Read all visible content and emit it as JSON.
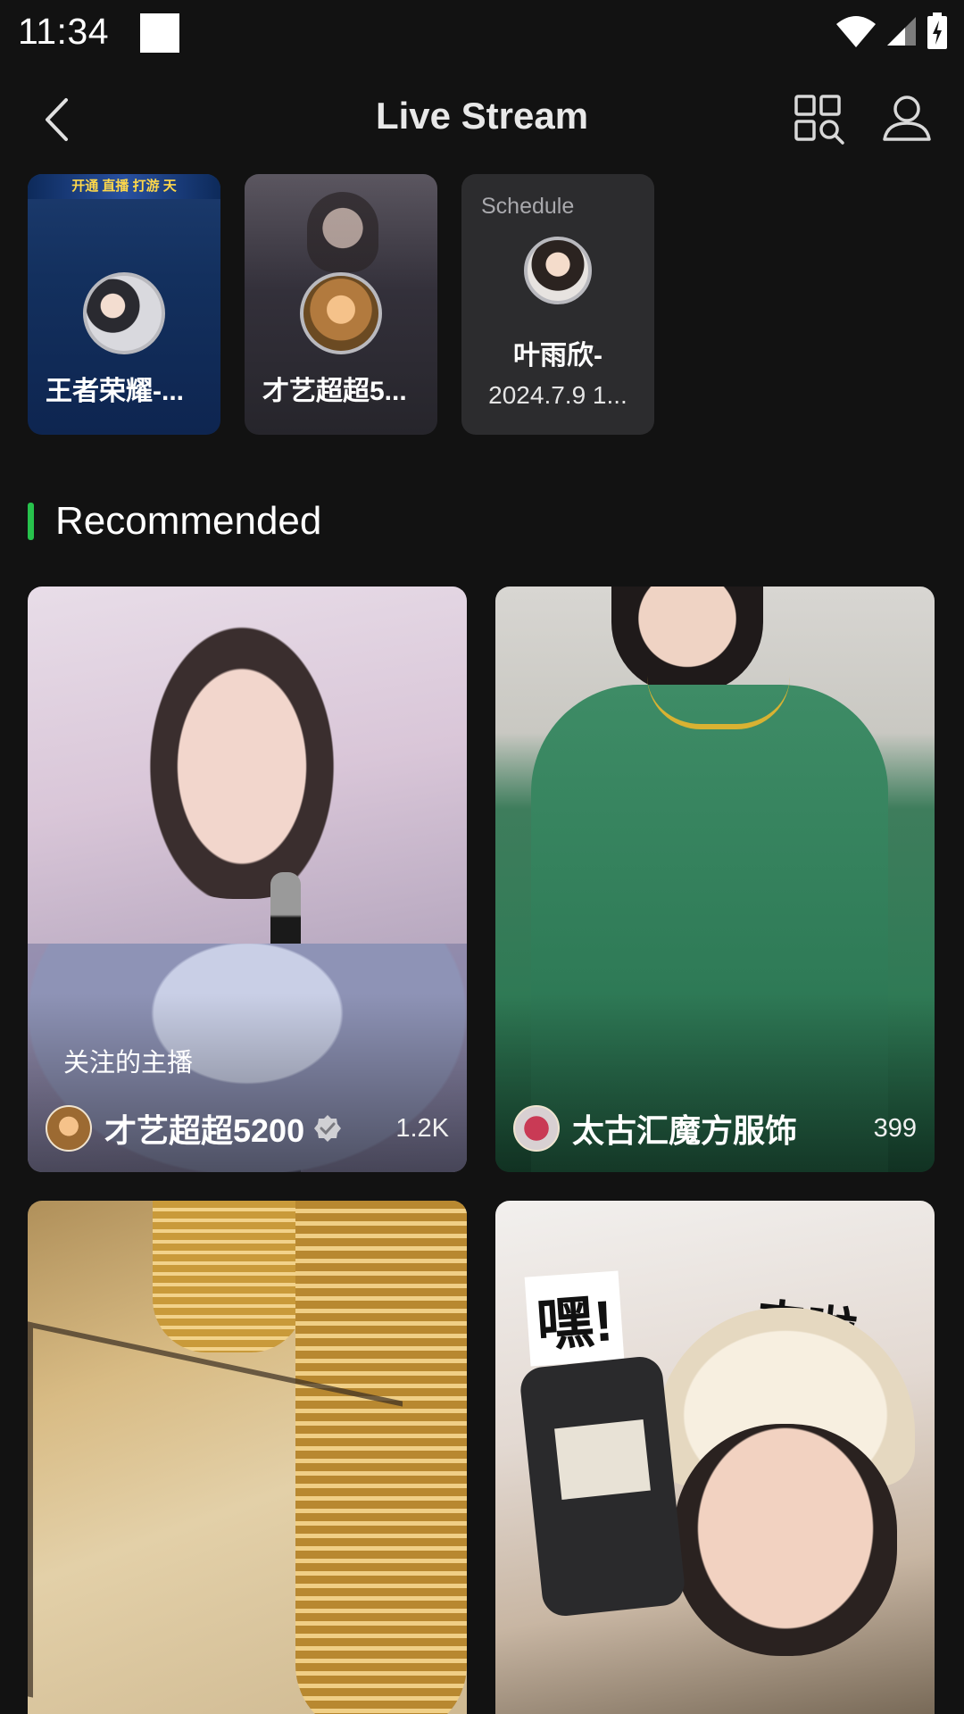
{
  "status_bar": {
    "time": "11:34"
  },
  "header": {
    "title": "Live Stream"
  },
  "live_row": [
    {
      "name": "王者荣耀-...",
      "banner": "开通 直播 打游 天"
    },
    {
      "name": "才艺超超5..."
    },
    {
      "label": "Schedule",
      "name": "叶雨欣-",
      "time": "2024.7.9 1..."
    }
  ],
  "section": {
    "title": "Recommended"
  },
  "recommended": [
    {
      "tag": "关注的主播",
      "name": "才艺超超5200",
      "viewers": "1.2K",
      "verified": true
    },
    {
      "name": "太古汇魔方服饰",
      "viewers": "399"
    },
    {},
    {
      "sticker_1": "嘿!",
      "sticker_2": "来啦"
    }
  ],
  "colors": {
    "accent": "#27c24c",
    "background": "#121212",
    "card": "#2c2c2e"
  }
}
